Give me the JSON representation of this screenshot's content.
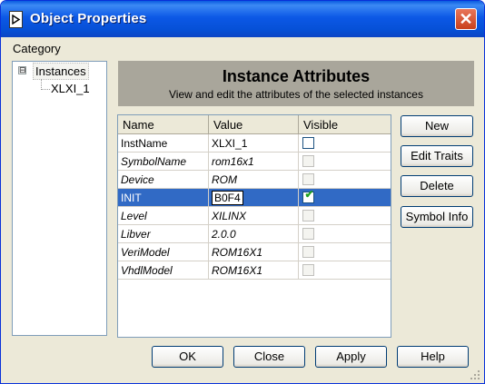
{
  "window": {
    "title": "Object Properties"
  },
  "category": {
    "label": "Category"
  },
  "tree": {
    "root": "Instances",
    "expander": "⊟",
    "child": "XLXI_1"
  },
  "panel": {
    "title": "Instance Attributes",
    "subtitle": "View and edit the attributes of the selected instances"
  },
  "grid": {
    "columns": [
      "Name",
      "Value",
      "Visible"
    ],
    "rows": [
      {
        "name": "InstName",
        "value": "XLXI_1",
        "visible": false,
        "editable": true
      },
      {
        "name": "SymbolName",
        "value": "rom16x1",
        "visible": false,
        "editable": false
      },
      {
        "name": "Device",
        "value": "ROM",
        "visible": false,
        "editable": false
      },
      {
        "name": "INIT",
        "value": "B0F4",
        "visible": true,
        "editable": true,
        "selected": true
      },
      {
        "name": "Level",
        "value": "XILINX",
        "visible": false,
        "editable": false
      },
      {
        "name": "Libver",
        "value": "2.0.0",
        "visible": false,
        "editable": false
      },
      {
        "name": "VeriModel",
        "value": "ROM16X1",
        "visible": false,
        "editable": false
      },
      {
        "name": "VhdlModel",
        "value": "ROM16X1",
        "visible": false,
        "editable": false
      }
    ]
  },
  "side_buttons": {
    "new": "New",
    "edit_traits": "Edit Traits",
    "delete": "Delete",
    "symbol_info": "Symbol Info"
  },
  "footer_buttons": {
    "ok": "OK",
    "close": "Close",
    "apply": "Apply",
    "help": "Help"
  },
  "colors": {
    "titlebar": "#0a5ce0",
    "selection": "#316ac5",
    "panel": "#a9a69b",
    "dialog": "#ece9d8"
  }
}
